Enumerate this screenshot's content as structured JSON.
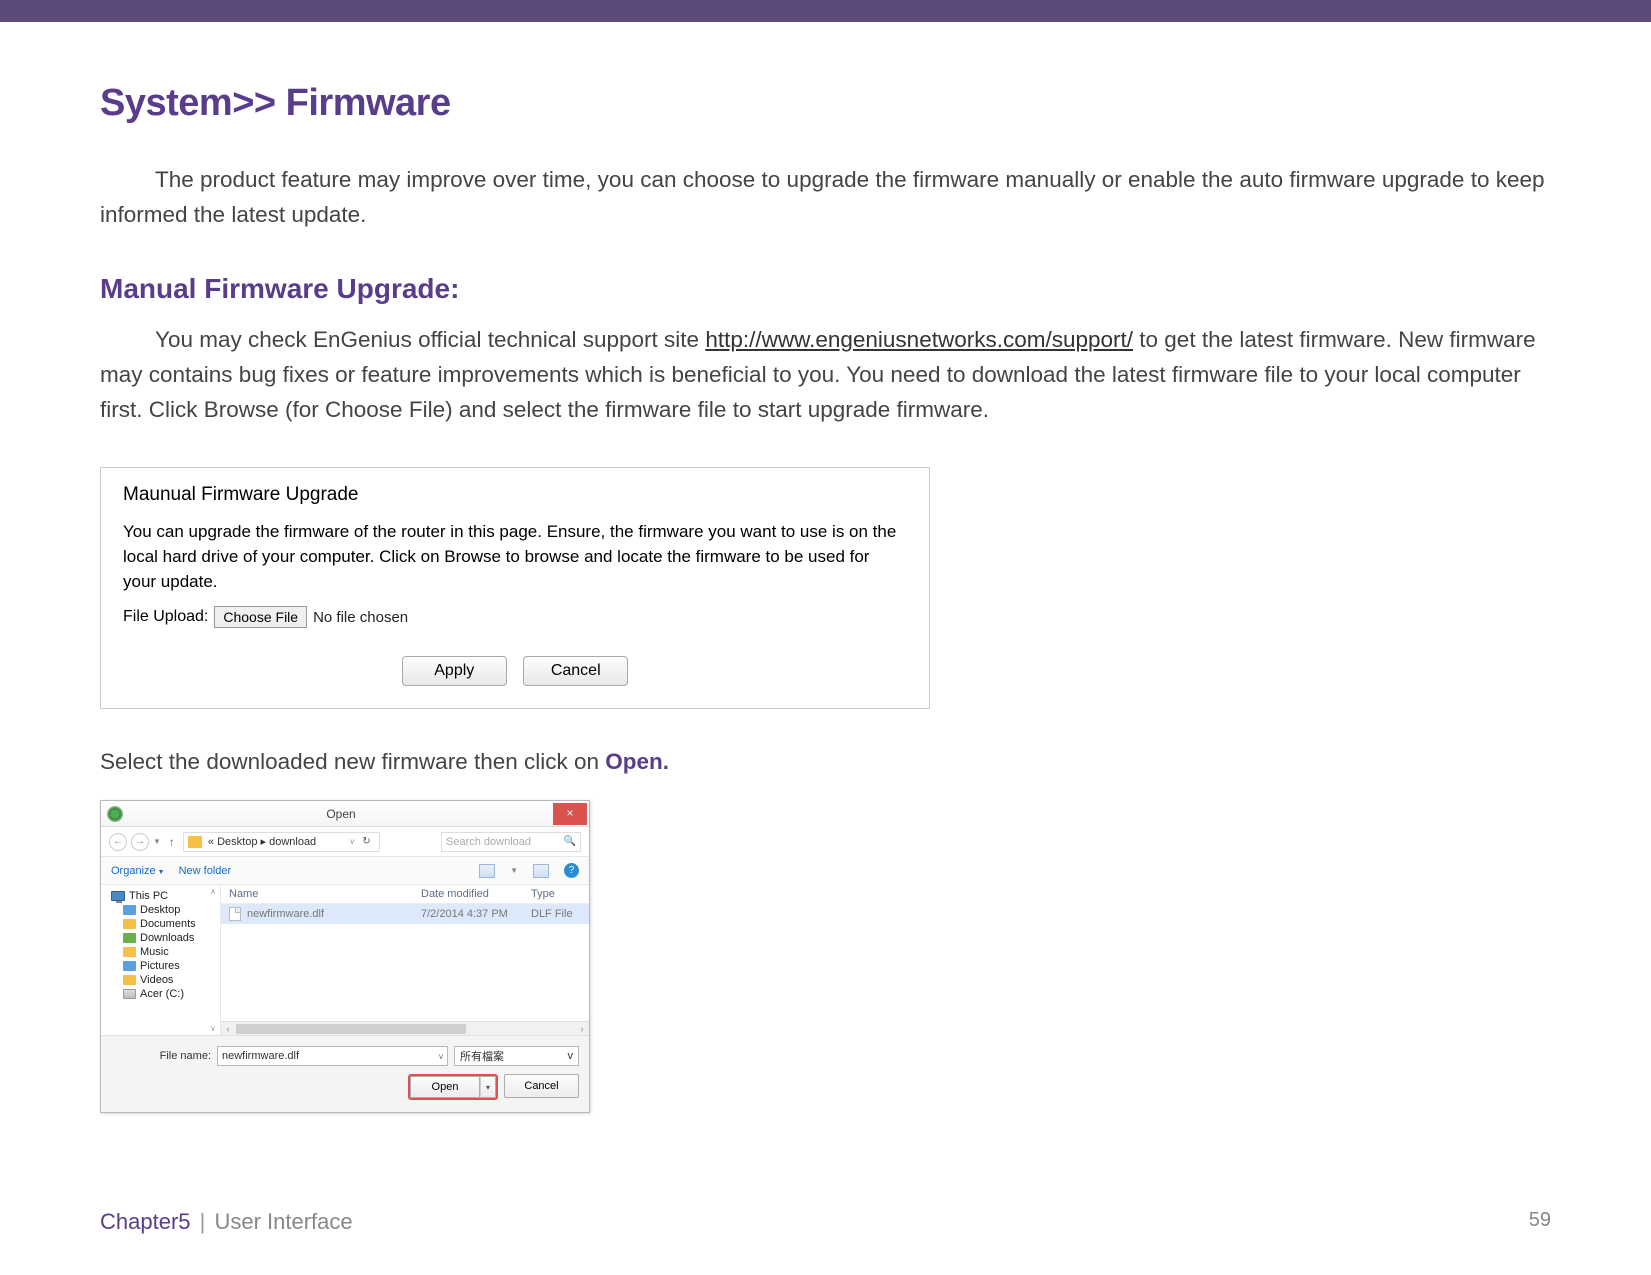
{
  "heading": "System>> Firmware",
  "intro": "The product feature may improve over time, you can choose to upgrade the firmware manually or enable the auto firmware upgrade to keep informed the latest update.",
  "section1_title": "Manual Firmware Upgrade:",
  "section1_pre": "You may check EnGenius official technical support site ",
  "section1_link": "http://www.engeniusnetworks.com/support/",
  "section1_post": " to get  the latest firmware. New firmware may contains bug fixes or feature improvements which is beneficial to you. You need to download the latest firmware file to your local computer first. Click Browse (for Choose File) and select the firmware file to start upgrade firmware.",
  "panel": {
    "title": "Maunual Firmware Upgrade",
    "desc": "You can upgrade the firmware of the router in this page. Ensure, the firmware you want to use is on the local hard drive of your computer. Click on Browse to browse and locate the firmware to be used for your update.",
    "file_label": "File Upload:",
    "choose_file": "Choose File",
    "no_file": "No file chosen",
    "apply": "Apply",
    "cancel": "Cancel"
  },
  "instruction_pre": "Select the downloaded new firmware then click on ",
  "instruction_hl": "Open.",
  "dialog": {
    "title": "Open",
    "path_prefix": "« Desktop ▸ download",
    "search_placeholder": "Search download",
    "organize": "Organize",
    "newfolder": "New folder",
    "col_name": "Name",
    "col_date": "Date modified",
    "col_type": "Type",
    "file_name": "newfirmware.dlf",
    "file_date": "7/2/2014 4:37 PM",
    "file_type": "DLF File",
    "tree": {
      "root": "This PC",
      "items": [
        "Desktop",
        "Documents",
        "Downloads",
        "Music",
        "Pictures",
        "Videos",
        "Acer (C:)"
      ]
    },
    "fn_label": "File name:",
    "fn_value": "newfirmware.dlf",
    "filter": "所有檔案",
    "open": "Open",
    "cancel": "Cancel"
  },
  "footer": {
    "chapter": "Chapter5",
    "section": "User Interface",
    "page": "59"
  }
}
